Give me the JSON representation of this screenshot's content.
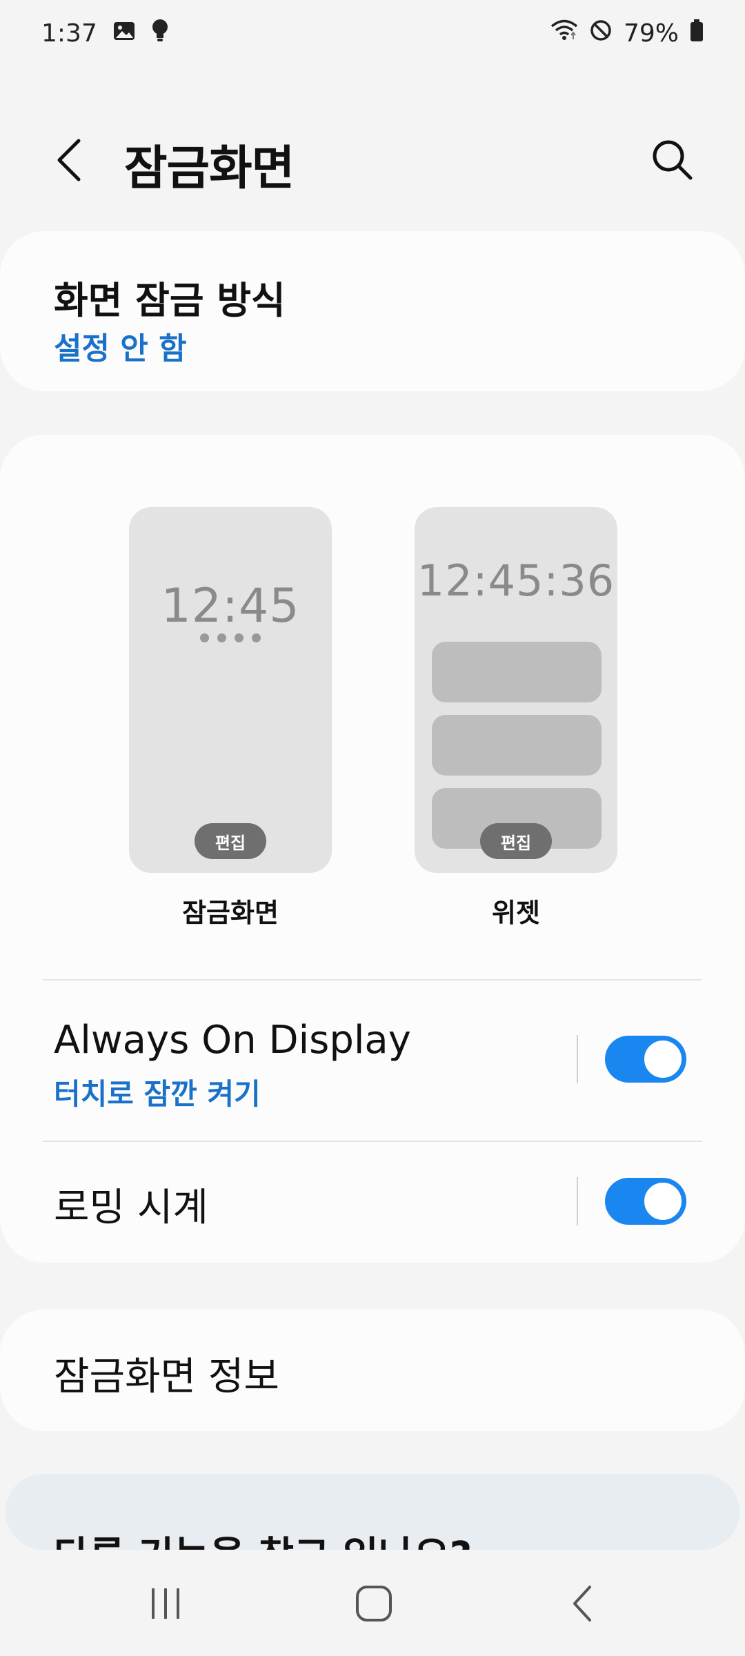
{
  "status_bar": {
    "time": "1:37",
    "battery_text": "79%",
    "icons": [
      "gallery-icon",
      "bulb-icon",
      "wifi-icon",
      "do-not-disturb-icon",
      "battery-icon"
    ]
  },
  "header": {
    "title": "잠금화면",
    "back_icon": "back-arrow-icon",
    "search_icon": "search-icon"
  },
  "lock_type": {
    "title": "화면 잠금 방식",
    "value": "설정 안 함"
  },
  "previews": {
    "lock_screen": {
      "clock": "12:45",
      "edit_label": "편집",
      "label": "잠금화면"
    },
    "widgets": {
      "clock": "12:45:36",
      "edit_label": "편집",
      "label": "위젯"
    }
  },
  "rows": {
    "aod": {
      "title": "Always On Display",
      "subtitle": "터치로 잠깐 켜기",
      "enabled": true
    },
    "roaming_clock": {
      "title": "로밍 시계",
      "enabled": true
    }
  },
  "info": {
    "title": "잠금화면 정보"
  },
  "help": {
    "title": "다른 기능을 찾고 있나요?"
  },
  "colors": {
    "accent": "#1a72c8",
    "toggle_on": "#1a86f0",
    "background": "#f4f4f4",
    "card": "#fcfcfc"
  }
}
